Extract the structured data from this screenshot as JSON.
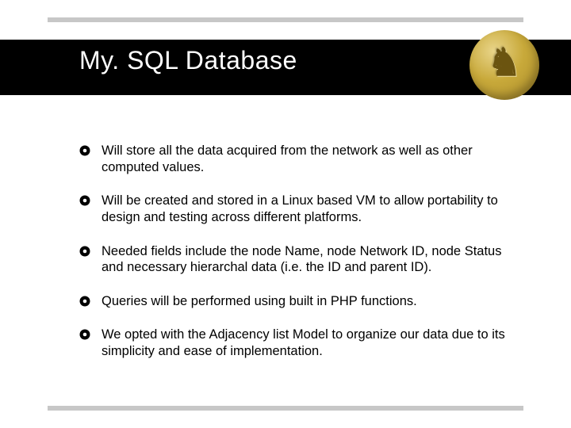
{
  "title": "My. SQL Database",
  "logo_glyph": "♞",
  "bullets": [
    {
      "text": "Will store all the data acquired from the network as well as other computed values."
    },
    {
      "text": "Will be created and stored in a Linux based VM to allow portability to design and testing across different platforms."
    },
    {
      "text": "Needed fields include the node Name, node Network ID, node Status and necessary hierarchal data (i.e. the ID and parent ID)."
    },
    {
      "text": "Queries will be performed using built in PHP functions."
    },
    {
      "text": "We opted with the Adjacency list Model to organize our data due to its simplicity and ease of implementation."
    }
  ]
}
